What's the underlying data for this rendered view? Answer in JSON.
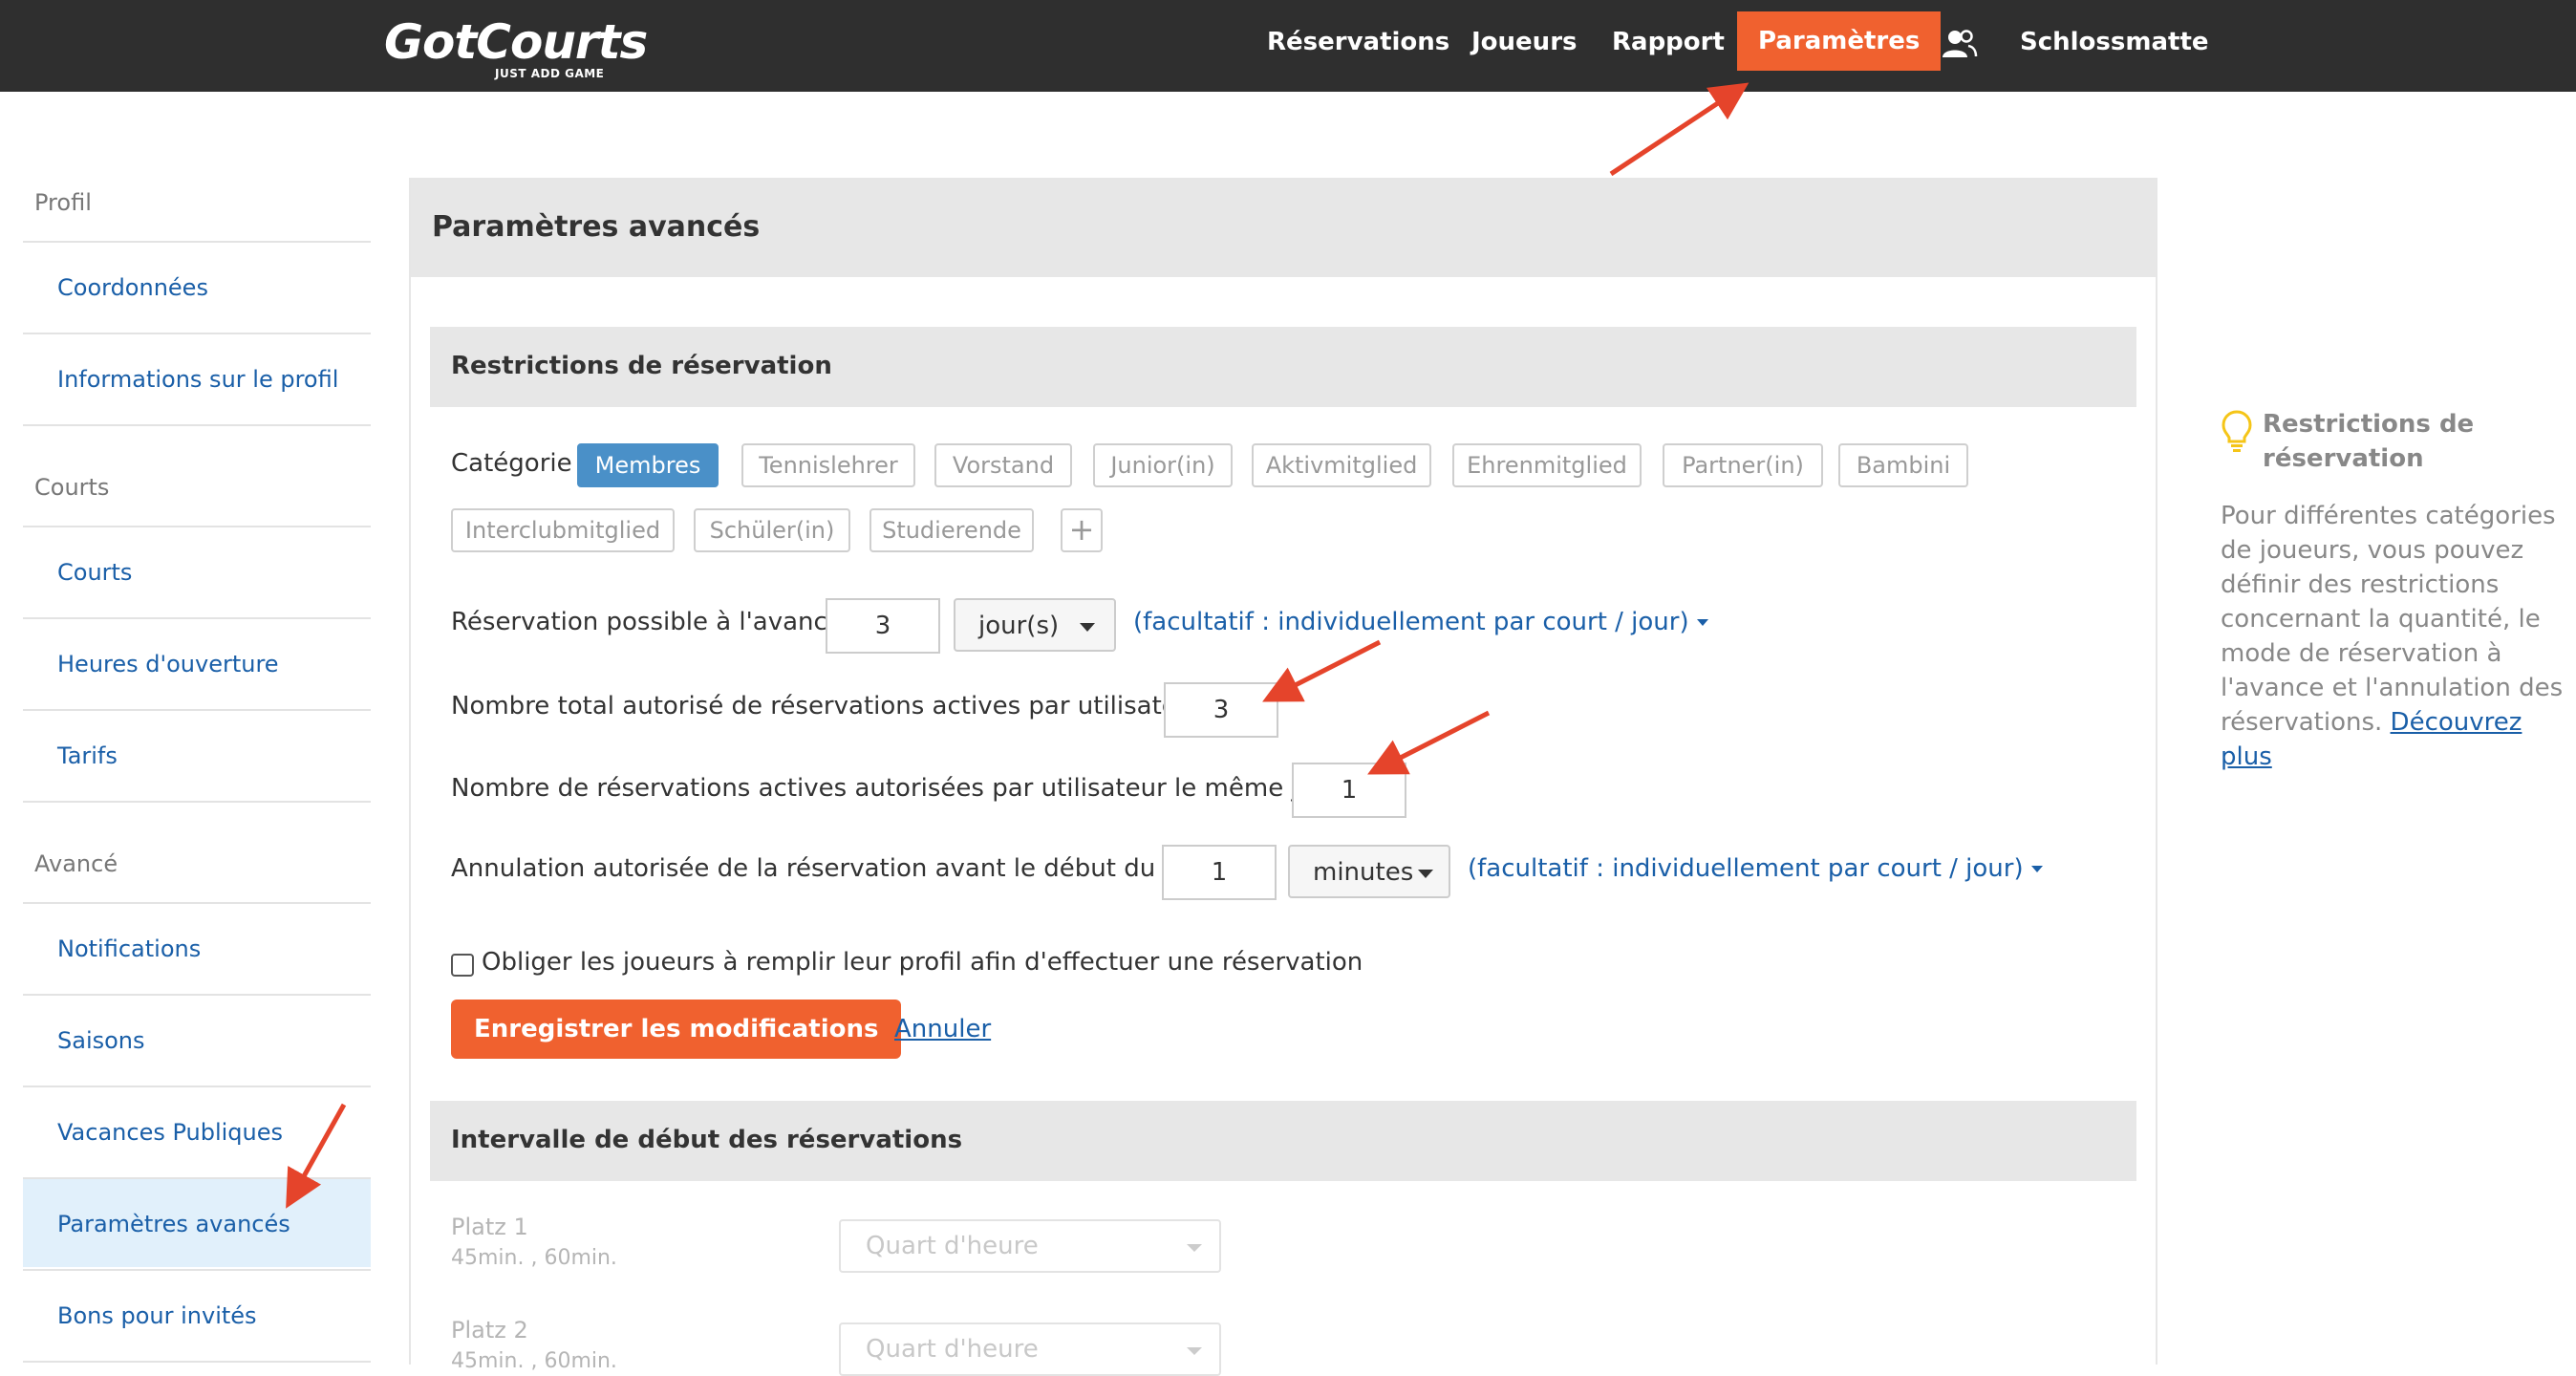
{
  "header": {
    "logo_text": "GotCourts",
    "logo_tagline": "JUST ADD GAME",
    "nav": [
      "Réservations",
      "Joueurs",
      "Rapport",
      "Paramètres"
    ],
    "club_name": "Schlossmatte"
  },
  "sidebar": {
    "section_profile": "Profil",
    "section_courts": "Courts",
    "section_advanced": "Avancé",
    "items": [
      "Coordonnées",
      "Informations sur le profil",
      "Courts",
      "Heures d'ouverture",
      "Tarifs",
      "Notifications",
      "Saisons",
      "Vacances Publiques",
      "Paramètres avancés",
      "Bons pour invités"
    ],
    "active_item": "Paramètres avancés"
  },
  "main": {
    "title": "Paramètres avancés",
    "restrictions": {
      "title": "Restrictions de réservation",
      "category_label": "Catégorie",
      "categories": [
        "Membres",
        "Tennislehrer",
        "Vorstand",
        "Junior(in)",
        "Aktivmitglied",
        "Ehrenmitglied",
        "Partner(in)",
        "Bambini",
        "Interclubmitglied",
        "Schüler(in)",
        "Studierende"
      ],
      "active_category": "Membres",
      "advance_label": "Réservation possible à l'avance :",
      "advance_value": "3",
      "advance_unit": "jour(s)",
      "optional_link": "(facultatif : individuellement par court / jour)",
      "total_label": "Nombre total autorisé de réservations actives par utilisateur :",
      "total_value": "3",
      "same_day_label": "Nombre de réservations actives autorisées par utilisateur le même jour :",
      "same_day_value": "1",
      "cancel_label": "Annulation autorisée de la réservation avant le début du jeu :",
      "cancel_value": "1",
      "cancel_unit": "minutes",
      "profile_checkbox_label": "Obliger les joueurs à remplir leur profil afin d'effectuer une réservation",
      "profile_checkbox_checked": false,
      "save_label": "Enregistrer les modifications",
      "cancel_link": "Annuler"
    },
    "interval": {
      "title": "Intervalle de début des réservations",
      "courts": [
        {
          "name": "Platz 1",
          "durations": "45min. , 60min.",
          "select": "Quart d'heure"
        },
        {
          "name": "Platz 2",
          "durations": "45min. , 60min.",
          "select": "Quart d'heure"
        }
      ]
    }
  },
  "tip": {
    "title": "Restrictions de réservation",
    "body": "Pour différentes catégories de joueurs, vous pouvez définir des restrictions concernant la quantité, le mode de réservation à l'avance et l'annulation des réservations.",
    "link": "Découvrez plus"
  },
  "colors": {
    "accent": "#f0612f",
    "link": "#1a5fa8",
    "tag_active": "#4a90c8",
    "annotation_arrow": "#e5442b"
  },
  "icons": {
    "users": "users-icon",
    "bulb": "lightbulb-icon",
    "add": "plus-icon"
  }
}
